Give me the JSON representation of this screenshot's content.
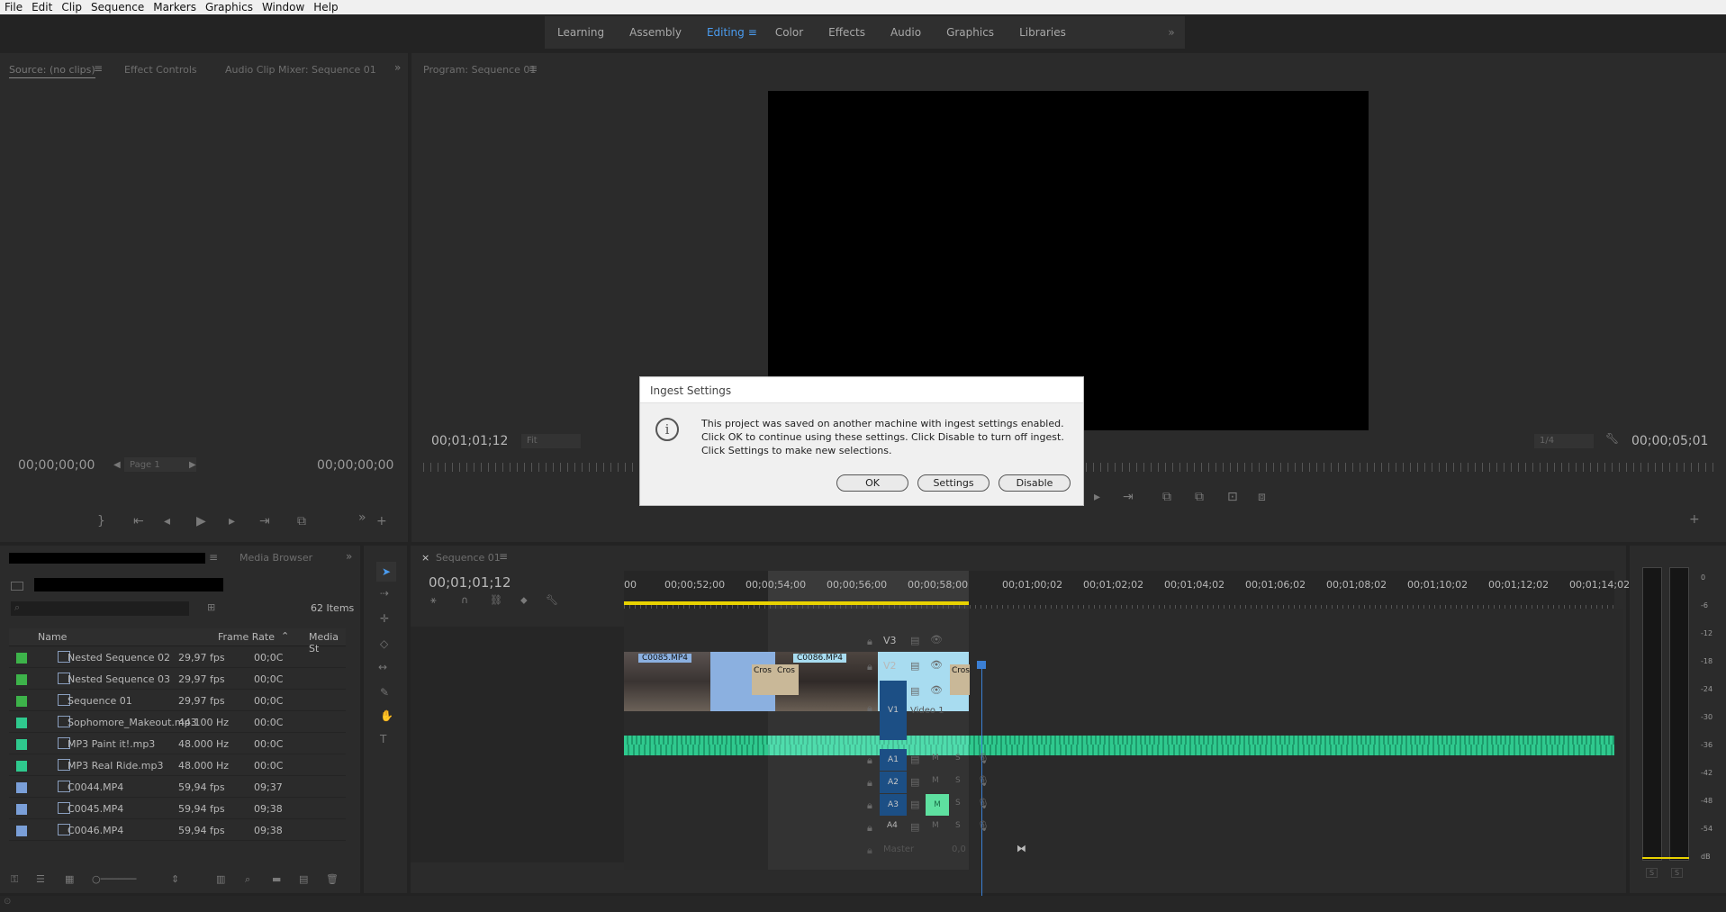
{
  "menu": [
    "File",
    "Edit",
    "Clip",
    "Sequence",
    "Markers",
    "Graphics",
    "Window",
    "Help"
  ],
  "workspaces": [
    "Learning",
    "Assembly",
    "Editing",
    "Color",
    "Effects",
    "Audio",
    "Graphics",
    "Libraries"
  ],
  "source_panel": {
    "tab_source": "Source: (no clips)",
    "tab_effects": "Effect Controls",
    "tab_mixer": "Audio Clip Mixer: Sequence 01",
    "tc_left": "00;00;00;00",
    "tc_right": "00;00;00;00",
    "page": "Page 1"
  },
  "program_panel": {
    "tab": "Program: Sequence 01",
    "tc_left": "00;01;01;12",
    "fit": "Fit",
    "quality": "1/4",
    "tc_right": "00;00;05;01"
  },
  "project_panel": {
    "tab_media": "Media Browser",
    "items_count": "62 Items",
    "col_name": "Name",
    "col_fps": "Frame Rate",
    "col_media": "Media St",
    "rows": [
      {
        "name": "Nested Sequence 02",
        "fps": "29,97 fps",
        "media": "00;0C",
        "color": "#3db34a",
        "type": "seq"
      },
      {
        "name": "Nested Sequence 03",
        "fps": "29,97 fps",
        "media": "00;0C",
        "color": "#3db34a",
        "type": "seq"
      },
      {
        "name": "Sequence 01",
        "fps": "29,97 fps",
        "media": "00;0C",
        "color": "#3db34a",
        "type": "seq"
      },
      {
        "name": "Sophomore_Makeout.mp3",
        "fps": "44.100 Hz",
        "media": "00:0C",
        "color": "#2fc98e",
        "type": "audio"
      },
      {
        "name": "MP3 Paint it!.mp3",
        "fps": "48.000 Hz",
        "media": "00:0C",
        "color": "#2fc98e",
        "type": "audio"
      },
      {
        "name": "MP3 Real Ride.mp3",
        "fps": "48.000 Hz",
        "media": "00:0C",
        "color": "#2fc98e",
        "type": "audio"
      },
      {
        "name": "C0044.MP4",
        "fps": "59,94 fps",
        "media": "09;37",
        "color": "#7a9fd8",
        "type": "video"
      },
      {
        "name": "C0045.MP4",
        "fps": "59,94 fps",
        "media": "09;38",
        "color": "#7a9fd8",
        "type": "video"
      },
      {
        "name": "C0046.MP4",
        "fps": "59,94 fps",
        "media": "09;38",
        "color": "#7a9fd8",
        "type": "video"
      }
    ]
  },
  "timeline": {
    "tab": "Sequence 01",
    "tc": "00;01;01;12",
    "ruler": [
      "00",
      "00;00;52;00",
      "00;00;54;00",
      "00;00;56;00",
      "00;00;58;00",
      "00;01;00;02",
      "00;01;02;02",
      "00;01;04;02",
      "00;01;06;02",
      "00;01;08;02",
      "00;01;10;02",
      "00;01;12;02",
      "00;01;14;02"
    ],
    "tracks": {
      "v3": "V3",
      "v2": "V2",
      "v1": "V1",
      "v1name": "Video 1",
      "a1": "A1",
      "a2": "A2",
      "a3": "A3",
      "a4": "A4",
      "master": "Master",
      "master_val": "0,0",
      "m": "M",
      "s": "S"
    },
    "clip1": "C0085.MP4",
    "clip2": "C0086.MP4",
    "cross": "Cros"
  },
  "meter": {
    "labels": [
      "0",
      "-6",
      "-12",
      "-18",
      "-24",
      "-30",
      "-36",
      "-42",
      "-48",
      "-54",
      "dB"
    ],
    "s": "S"
  },
  "dialog": {
    "title": "Ingest Settings",
    "message": "This project was saved on another machine with ingest settings enabled. Click OK to continue using these settings. Click Disable to turn off ingest. Click Settings to make new selections.",
    "ok": "OK",
    "settings": "Settings",
    "disable": "Disable"
  }
}
